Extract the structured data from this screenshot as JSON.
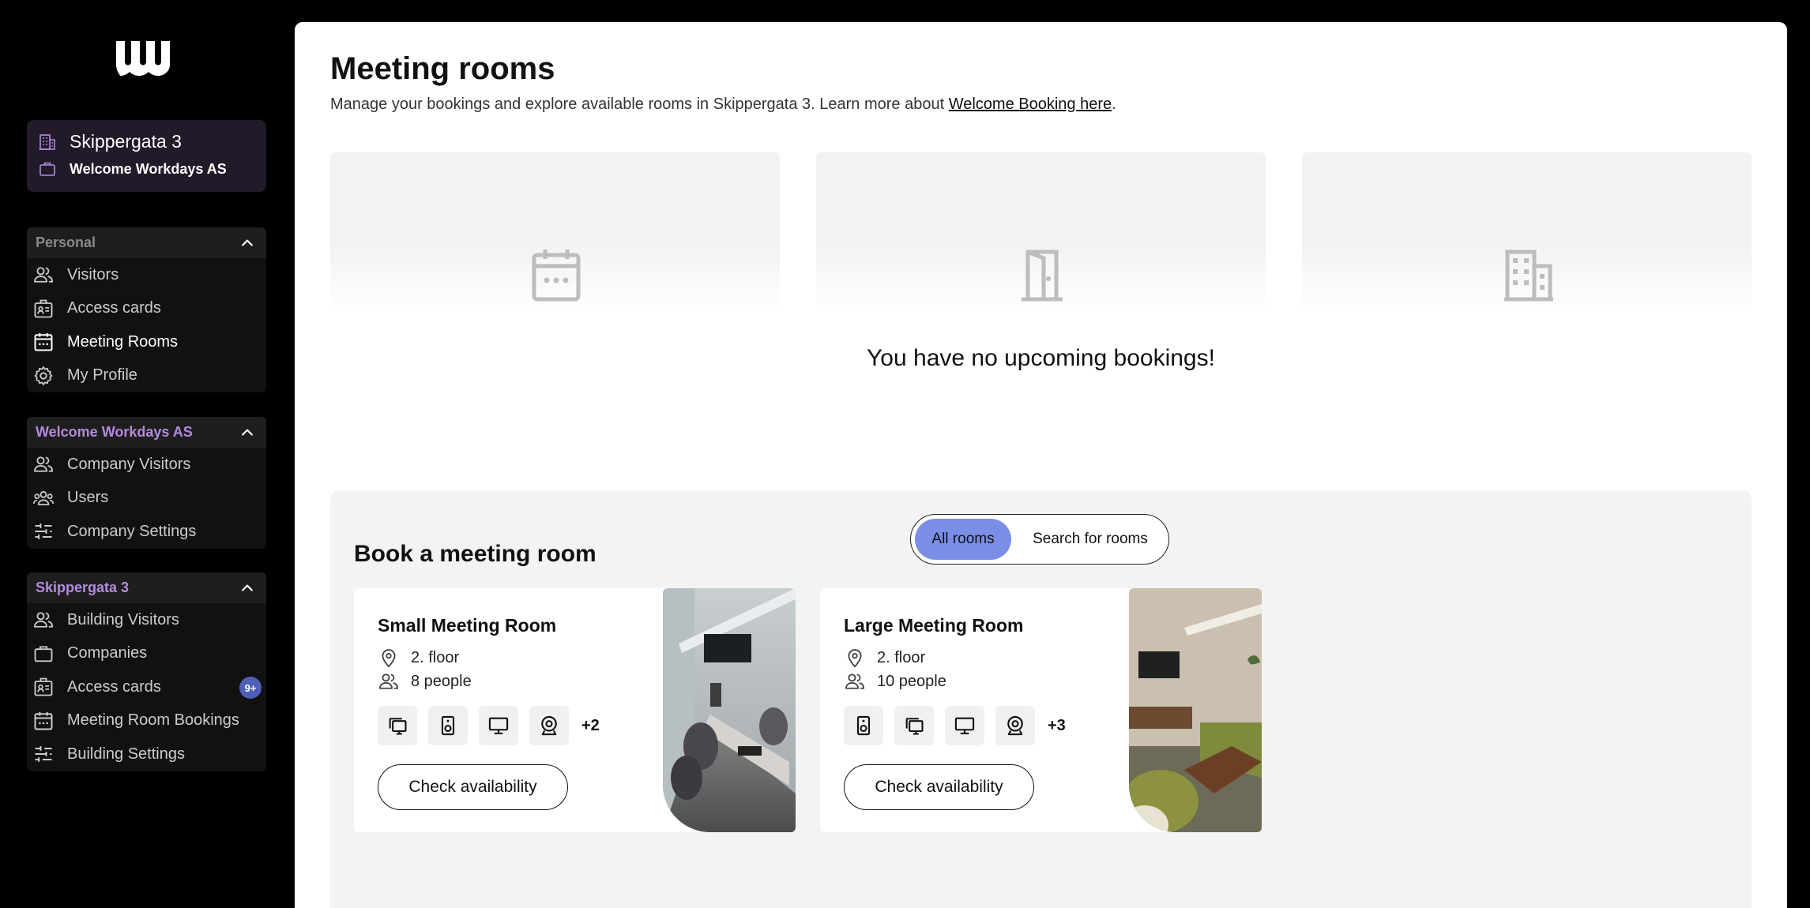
{
  "context": {
    "building": "Skippergata 3",
    "company": "Welcome Workdays AS"
  },
  "nav": {
    "personal": {
      "header": "Personal",
      "items": [
        "Visitors",
        "Access cards",
        "Meeting Rooms",
        "My Profile"
      ]
    },
    "company": {
      "header": "Welcome Workdays AS",
      "items": [
        "Company Visitors",
        "Users",
        "Company Settings"
      ]
    },
    "building": {
      "header": "Skippergata 3",
      "items": [
        "Building Visitors",
        "Companies",
        "Access cards",
        "Meeting Room Bookings",
        "Building Settings"
      ],
      "badge": "9+"
    }
  },
  "colors": {
    "accent": "#7b8ee6",
    "nav_header_purple": "#b48be0",
    "nav_header_gray": "#8a8a8a",
    "badge": "#4f5fb8"
  },
  "page": {
    "title": "Meeting rooms",
    "subtitle_prefix": "Manage your bookings and explore available rooms in Skippergata 3. Learn more about ",
    "subtitle_link": "Welcome Booking here",
    "subtitle_suffix": ".",
    "empty_message": "You have no upcoming bookings!"
  },
  "booking": {
    "title": "Book a meeting room",
    "toggle": {
      "all": "All rooms",
      "search": "Search for rooms"
    },
    "rooms": [
      {
        "name": "Small Meeting Room",
        "floor": "2. floor",
        "capacity": "8 people",
        "amenities": [
          "screen-share-icon",
          "speaker-icon",
          "monitor-icon",
          "webcam-icon"
        ],
        "more": "+2",
        "button": "Check availability"
      },
      {
        "name": "Large Meeting Room",
        "floor": "2. floor",
        "capacity": "10 people",
        "amenities": [
          "speaker-icon",
          "screen-share-icon",
          "monitor-icon",
          "webcam-icon"
        ],
        "more": "+3",
        "button": "Check availability"
      }
    ]
  }
}
